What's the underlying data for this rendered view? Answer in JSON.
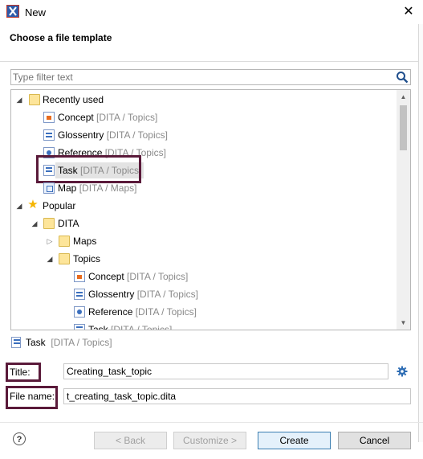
{
  "window": {
    "title": "New",
    "close_glyph": "✕"
  },
  "header": {
    "title": "Choose a file template"
  },
  "filter": {
    "placeholder": "Type filter text"
  },
  "tree": {
    "recently_used": {
      "label": "Recently used",
      "items": [
        {
          "name": "Concept",
          "category": "[DITA / Topics]",
          "icon": "concept-icon"
        },
        {
          "name": "Glossentry",
          "category": "[DITA / Topics]",
          "icon": "glossentry-icon"
        },
        {
          "name": "Reference",
          "category": "[DITA / Topics]",
          "icon": "reference-icon"
        },
        {
          "name": "Task",
          "category": "[DITA / Topics]",
          "icon": "task-icon",
          "selected": true
        },
        {
          "name": "Map",
          "category": "[DITA / Maps]",
          "icon": "map-icon"
        }
      ]
    },
    "popular": {
      "label": "Popular",
      "dita": {
        "label": "DITA",
        "maps": {
          "label": "Maps"
        },
        "topics": {
          "label": "Topics",
          "items": [
            {
              "name": "Concept",
              "category": "[DITA / Topics]",
              "icon": "concept-icon"
            },
            {
              "name": "Glossentry",
              "category": "[DITA / Topics]",
              "icon": "glossentry-icon"
            },
            {
              "name": "Reference",
              "category": "[DITA / Topics]",
              "icon": "reference-icon"
            },
            {
              "name": "Task",
              "category": "[DITA / Topics]",
              "icon": "task-icon"
            }
          ]
        }
      }
    }
  },
  "description": {
    "name": "Task",
    "category": "[DITA / Topics]"
  },
  "form": {
    "title_label": "Title:",
    "title_value": "Creating_task_topic",
    "filename_label": "File name:",
    "filename_value": "t_creating_task_topic.dita"
  },
  "buttons": {
    "help": "?",
    "back": "< Back",
    "customize": "Customize >",
    "create": "Create",
    "cancel": "Cancel"
  },
  "colors": {
    "highlight_box": "#5a1a3a",
    "accent": "#2e5aa8"
  }
}
